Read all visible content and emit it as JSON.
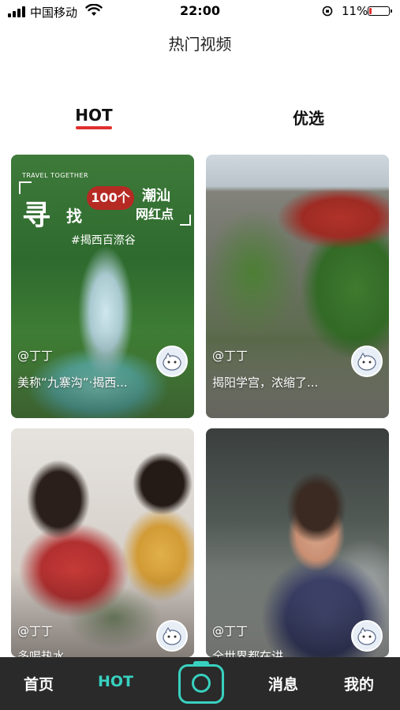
{
  "status_bar": {
    "carrier": "中国移动",
    "time": "22:00",
    "battery_percent": "11%",
    "battery_level": 0.11,
    "battery_color": "#e0302e"
  },
  "header": {
    "title": "热门视频"
  },
  "tabs": [
    {
      "label": "HOT",
      "active": true,
      "underline_color": "#e0302e"
    },
    {
      "label": "优选",
      "active": false
    }
  ],
  "cards": [
    {
      "author": "@丁丁",
      "caption": "美称“九寨沟”·揭西...",
      "overlay": {
        "tagline": "TRAVEL TOGETHER",
        "big_char": "寻",
        "small_char": "找",
        "badge": "100个",
        "region": "潮汕",
        "hot_spot": "网红点",
        "place": "#揭西百漈谷"
      }
    },
    {
      "author": "@丁丁",
      "caption": "揭阳学宫，浓缩了..."
    },
    {
      "author": "@丁丁",
      "caption": "多喝热水"
    },
    {
      "author": "@丁丁",
      "caption": "全世界都在讲"
    }
  ],
  "bottom_nav": {
    "items": [
      {
        "label": "首页",
        "active": false
      },
      {
        "label": "HOT",
        "active": true
      },
      {
        "label": "消息",
        "active": false
      },
      {
        "label": "我的",
        "active": false
      }
    ],
    "center_icon": "camera-icon",
    "accent_color": "#38d1c0"
  }
}
